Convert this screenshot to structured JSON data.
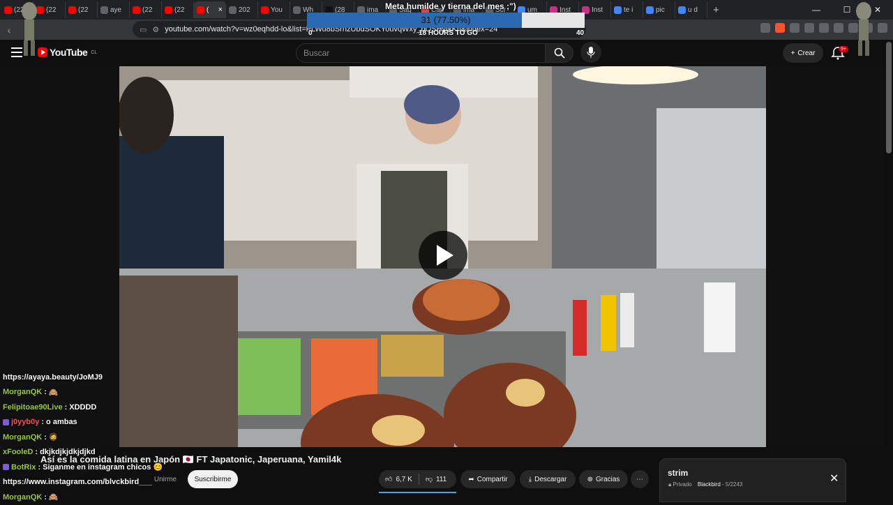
{
  "browser": {
    "tabs": [
      {
        "label": "(22",
        "color": "#ff0000"
      },
      {
        "label": "(22",
        "color": "#ff0000"
      },
      {
        "label": "(22",
        "color": "#ff0000"
      },
      {
        "label": "aye",
        "color": "#5f6368"
      },
      {
        "label": "(22",
        "color": "#ff0000"
      },
      {
        "label": "(22",
        "color": "#ff0000"
      },
      {
        "label": "(",
        "color": "#ff0000",
        "active": true
      },
      {
        "label": "202",
        "color": "#5f6368"
      },
      {
        "label": "You",
        "color": "#ff0000"
      },
      {
        "label": "Wh",
        "color": "#5f6368"
      },
      {
        "label": "(28",
        "color": "#111111"
      },
      {
        "label": "ima",
        "color": "#5f6368"
      },
      {
        "label": "Sag",
        "color": "#5f6368"
      },
      {
        "label": "Cap",
        "color": "#e8453c"
      },
      {
        "label": "ima",
        "color": "#5f6368"
      },
      {
        "label": "Scr",
        "color": "#5f6368"
      },
      {
        "label": "um",
        "color": "#4285f4"
      },
      {
        "label": "Inst",
        "color": "#c13584"
      },
      {
        "label": "Inst",
        "color": "#c13584"
      },
      {
        "label": "te i",
        "color": "#4285f4"
      },
      {
        "label": "pic",
        "color": "#4285f4"
      },
      {
        "label": "u d",
        "color": "#4285f4"
      }
    ],
    "tab_close": "×",
    "new_tab": "+",
    "window_controls": [
      "—",
      "☐",
      "✕"
    ],
    "url": "youtube.com/watch?v=wz0eqhdd-lo&list=PLWu8bSrhzUbdSOKYouvqWxy_bOSHyIkKh&index=24"
  },
  "overlay": {
    "goal_title": "Meta humilde y tierna del mes ;\")",
    "goal_value_text": "31 (77.50%)",
    "goal_fraction": 0.775,
    "goal_min": "0",
    "goal_max": "40",
    "goal_time": "18 HOURS TO GO"
  },
  "youtube": {
    "logo_text": "YouTube",
    "region": "CL",
    "search_placeholder": "Buscar",
    "create_label": "Crear",
    "notif_badge": "9+",
    "video_title": "Así es la comida latina en Japón 🇯🇵 FT Japatonic, Japeruana, Yamil4k",
    "join_label": "Unirme",
    "subscribe_label": "Suscribirme",
    "likes": "6,7 K",
    "dislikes": "111",
    "share_label": "Compartir",
    "download_label": "Descargar",
    "thanks_label": "Gracias",
    "more_label": "⋯",
    "miniplaylist": {
      "title": "strim",
      "privacy": "Privado",
      "owner": "Blackbird",
      "position": "5/2243",
      "close": "✕"
    }
  },
  "chat": [
    {
      "user": "",
      "msg": "https://ayaya.beauty/JoMJ9",
      "color": "#ffffff"
    },
    {
      "user": "MorganQK",
      "msg": "🙈",
      "color": "#9acd32"
    },
    {
      "user": "Felipitoae90Live",
      "msg": "XDDDD",
      "color": "#9acd32"
    },
    {
      "user": "j0yyb0y",
      "msg": "o ambas",
      "color": "#ff4f4f",
      "badges": true
    },
    {
      "user": "MorganQK",
      "msg": "🧔",
      "color": "#9acd32"
    },
    {
      "user": "xFooleD",
      "msg": "dkjkdjkjdkjdjkd",
      "color": "#9acd32"
    },
    {
      "user": "BotRix",
      "msg": "Siganme en instagram chicos 😊",
      "color": "#9acd32",
      "badges": true
    },
    {
      "user": "",
      "msg": "https://www.instagram.com/blvckbird___",
      "color": "#ffffff"
    },
    {
      "user": "MorganQK",
      "msg": "🙈",
      "color": "#9acd32"
    }
  ]
}
